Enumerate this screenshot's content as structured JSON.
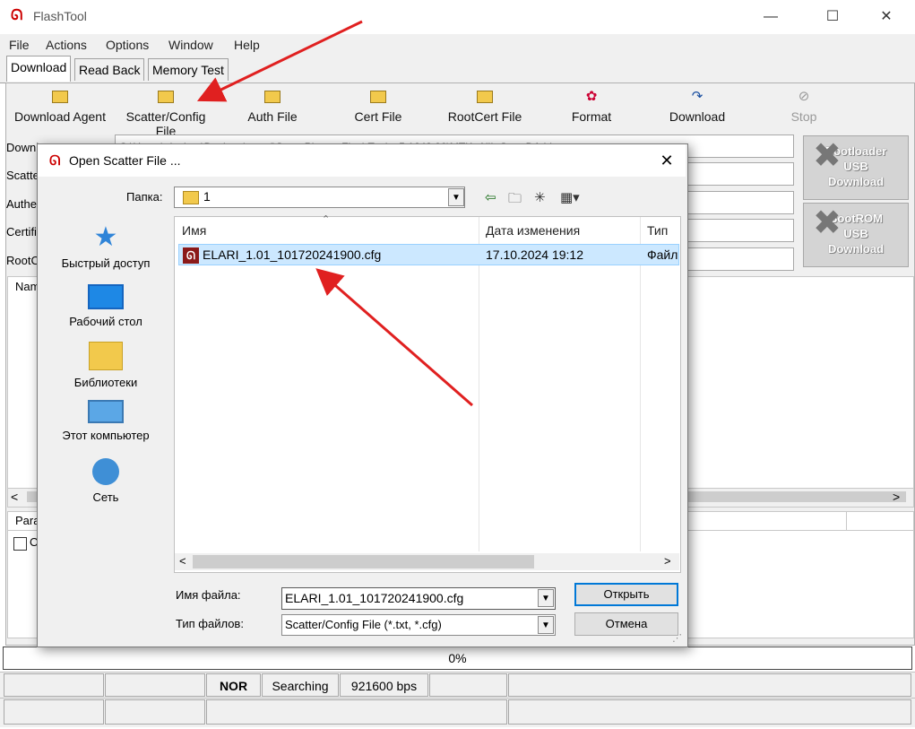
{
  "window": {
    "title": "FlashTool",
    "minimize": "—",
    "maximize": "☐",
    "close": "✕"
  },
  "menu": [
    "File",
    "Actions",
    "Options",
    "Window",
    "Help"
  ],
  "tabs": [
    "Download",
    "Read Back",
    "Memory Test"
  ],
  "toolbar": [
    "Download Agent",
    "Scatter/Config File",
    "Auth File",
    "Cert File",
    "RootCert File",
    "Format",
    "Download",
    "Stop"
  ],
  "fields": {
    "labels": [
      "Downl",
      "Scatte",
      "Authe",
      "Certifi",
      "RootC"
    ],
    "download_agent_value": "C:\\Users\\alexbox\\Desktop\\prstol\\SmartPhone_FlashTool_v5.1648.00\\MTK_AllInOne_DA.bin"
  },
  "side_buttons": {
    "bootloader": [
      "Bootloader",
      "USB",
      "Download"
    ],
    "bootrom": [
      "BootROM",
      "USB",
      "Download"
    ]
  },
  "list": {
    "header": "Nam",
    "scroll_left": "<",
    "scroll_right": ">"
  },
  "params": {
    "header": "Para",
    "checkbox_label": "O"
  },
  "progress": {
    "text": "0%",
    "value": 0
  },
  "status": {
    "storage": "NOR",
    "state": "Searching",
    "baud": "921600 bps"
  },
  "dialog": {
    "title": "Open Scatter File ...",
    "close": "✕",
    "look_in_label": "Папка:",
    "look_in_value": "1",
    "places": [
      "Быстрый доступ",
      "Рабочий стол",
      "Библиотеки",
      "Этот компьютер",
      "Сеть"
    ],
    "columns": [
      "Имя",
      "Дата изменения",
      "Тип"
    ],
    "files": [
      {
        "name": "ELARI_1.01_101720241900.cfg",
        "date": "17.10.2024 19:12",
        "type": "Файл"
      }
    ],
    "filename_label": "Имя файла:",
    "filename_value": "ELARI_1.01_101720241900.cfg",
    "filetype_label": "Тип файлов:",
    "filetype_value": "Scatter/Config File (*.txt, *.cfg)",
    "open_button": "Открыть",
    "cancel_button": "Отмена",
    "scroll_left": "<",
    "scroll_right": ">"
  },
  "colors": {
    "accent": "#0078d7",
    "selection": "#cce8ff",
    "annotation_arrow": "#e02020"
  }
}
